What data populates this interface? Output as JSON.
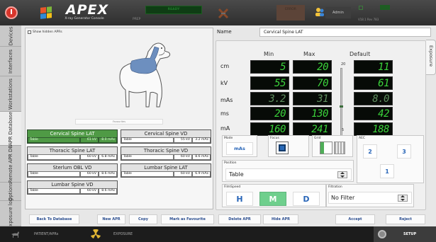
{
  "header": {
    "brand": "APEX",
    "subtitle": "X-ray Generator Console",
    "prep_label": "PREP",
    "ready_label": "READY",
    "error_label": "ERROR",
    "user": "Admin",
    "version": "V18.1 Rev 783",
    "status_left": "",
    "status_right": ""
  },
  "vtabs": [
    "Devices",
    "Interfaces",
    "Workstations",
    "APR Database",
    "Remote APR DB",
    "Options",
    "Exposure log"
  ],
  "left": {
    "show_hidden": "Show hidden APRs",
    "favourites": "Favourites",
    "aprs": [
      {
        "name": "Cervical Spine LAT",
        "position": "Table",
        "kv": "61 kV",
        "mas": "8.0 mAs",
        "selected": true
      },
      {
        "name": "Cervical Spine VD",
        "position": "Table",
        "kv": "55 kV",
        "mas": "3.2 mAs",
        "selected": false
      },
      {
        "name": "Thoracic Spine LAT",
        "position": "Table",
        "kv": "60 kV",
        "mas": "6.8 mAs",
        "selected": false
      },
      {
        "name": "Thoracic Spine VD",
        "position": "Table",
        "kv": "60 kV",
        "mas": "8.6 mAs",
        "selected": false
      },
      {
        "name": "Sterlum OBL VD",
        "position": "Table",
        "kv": "60 kV",
        "mas": "8.6 mAs",
        "selected": false
      },
      {
        "name": "Lumbar Spine LAT",
        "position": "Table",
        "kv": "60 kV",
        "mas": "6.9 mAs",
        "selected": false
      },
      {
        "name": "Lumbar Spine VD",
        "position": "Table",
        "kv": "60 kV",
        "mas": "8.6 mAs",
        "selected": false
      }
    ]
  },
  "right": {
    "name_label": "Name",
    "name_value": "Cervical Spine LAT",
    "exposure_tab": "Exposure",
    "columns": {
      "min": "Min",
      "max": "Max",
      "default": "Default"
    },
    "rows": [
      {
        "label": "cm",
        "min": "5",
        "max": "20",
        "default": "11"
      },
      {
        "label": "kV",
        "min": "55",
        "max": "70",
        "default": "61"
      },
      {
        "label": "mAs",
        "min": "3.2",
        "max": "31",
        "default": "8.0"
      },
      {
        "label": "ms",
        "min": "20",
        "max": "130",
        "default": "42"
      },
      {
        "label": "mA",
        "min": "160",
        "max": "241",
        "default": "188"
      }
    ],
    "slider_max": "20",
    "slider_min": "5",
    "mode_label": "Mode",
    "mode_value": "mAs",
    "focus_label": "Focus",
    "grid_label": "Grid",
    "aec_label": "AEC",
    "aec_buttons": [
      "2",
      "3",
      "1"
    ],
    "position_label": "Position",
    "position_value": "Table",
    "filmspeed_label": "FilmSpeed",
    "filmspeed_options": [
      "H",
      "M",
      "D"
    ],
    "filmspeed_selected": "M",
    "filtration_label": "Filtration",
    "filtration_value": "No Filter"
  },
  "buttons": {
    "back": "Back To Database",
    "new": "New APR",
    "copy": "Copy",
    "favourite": "Mark as Favourite",
    "delete": "Delete APR",
    "hide": "Hide APR",
    "accept": "Accept",
    "reject": "Reject"
  },
  "footer": {
    "patient": "PATIENT/APRs",
    "exposure": "EXPOSURE",
    "setup": "SETUP"
  },
  "colors": {
    "selected_green": "#4f9a45",
    "lcd_green": "#3bd33b",
    "filmspeed_selected": "#6fcf8d",
    "accent_blue": "#2966b8"
  }
}
